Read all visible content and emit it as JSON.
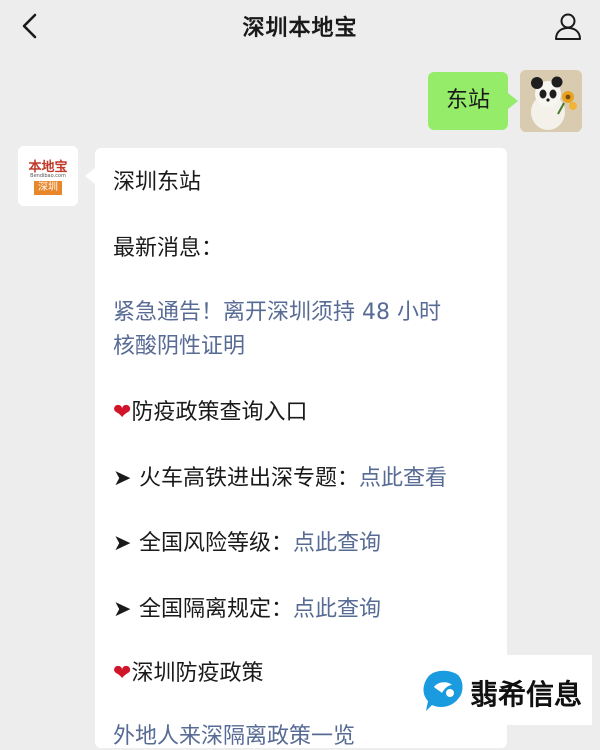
{
  "header": {
    "title": "深圳本地宝",
    "back_icon": "chevron-left-icon",
    "profile_icon": "person-icon"
  },
  "outgoing": {
    "text": "东站"
  },
  "bot": {
    "logo_top": "本地宝",
    "logo_domain": "Bendibao.com",
    "logo_city": "深圳"
  },
  "message": {
    "title": "深圳东站",
    "news_heading": "最新消息：",
    "notice_line1": "紧急通告！离开深圳须持 48 小时",
    "notice_line2": "核酸阴性证明",
    "section1": "防疫政策查询入口",
    "item1_label": "火车高铁进出深专题：",
    "item1_link": "点此查看",
    "item2_label": "全国风险等级：",
    "item2_link": "点此查询",
    "item3_label": "全国隔离规定：",
    "item3_link": "点此查询",
    "section2": "深圳防疫政策",
    "cutoff": "外地人来深隔离政策一览"
  },
  "watermark": {
    "text": "翡希信息"
  },
  "colors": {
    "background": "#ededed",
    "bubble_out": "#95ec69",
    "bubble_in": "#ffffff",
    "link": "#576b95",
    "heart": "#d0152b"
  }
}
